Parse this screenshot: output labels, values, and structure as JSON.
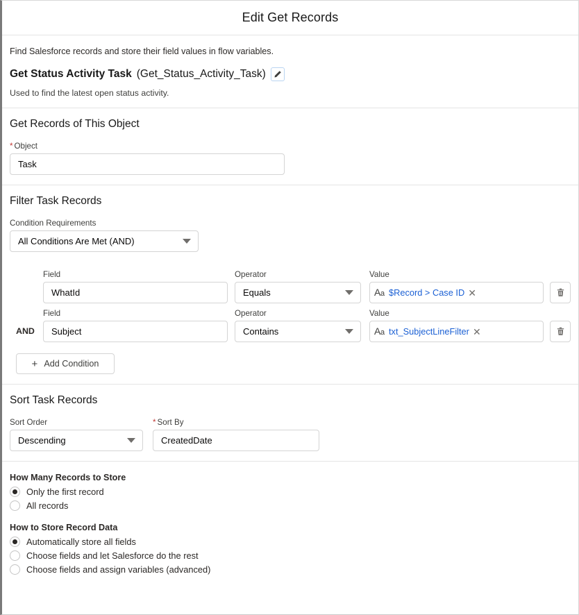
{
  "header": {
    "title": "Edit Get Records"
  },
  "intro": {
    "description": "Find Salesforce records and store their field values in flow variables.",
    "element_label": "Get Status Activity Task",
    "element_api_name": "(Get_Status_Activity_Task)",
    "edit_icon": "pencil-icon",
    "element_description": "Used to find the latest open status activity."
  },
  "object_section": {
    "title": "Get Records of This Object",
    "object_field_label": "Object",
    "object_required": "*",
    "object_value": "Task"
  },
  "filter_section": {
    "title": "Filter Task Records",
    "condition_requirements_label": "Condition Requirements",
    "condition_requirements_value": "All Conditions Are Met (AND)",
    "column_headers": {
      "field": "Field",
      "operator": "Operator",
      "value": "Value"
    },
    "logic_operator": "AND",
    "conditions": [
      {
        "field": "WhatId",
        "operator": "Equals",
        "value": "$Record > Case ID",
        "value_type_icon": "text-type-icon",
        "remove_icon": "close-icon",
        "delete_icon": "trash-icon"
      },
      {
        "field": "Subject",
        "operator": "Contains",
        "value": "txt_SubjectLineFilter",
        "value_type_icon": "text-type-icon",
        "remove_icon": "close-icon",
        "delete_icon": "trash-icon"
      }
    ],
    "add_condition_label": "Add Condition",
    "add_condition_icon": "plus-icon"
  },
  "sort_section": {
    "title": "Sort Task Records",
    "sort_order_label": "Sort Order",
    "sort_order_value": "Descending",
    "sort_by_label": "Sort By",
    "sort_by_required": "*",
    "sort_by_value": "CreatedDate"
  },
  "storage_section": {
    "how_many_title": "How Many Records to Store",
    "how_many_options": [
      {
        "label": "Only the first record",
        "selected": true
      },
      {
        "label": "All records",
        "selected": false
      }
    ],
    "how_to_store_title": "How to Store Record Data",
    "how_to_store_options": [
      {
        "label": "Automatically store all fields",
        "selected": true
      },
      {
        "label": "Choose fields and let Salesforce do the rest",
        "selected": false
      },
      {
        "label": "Choose fields and assign variables (advanced)",
        "selected": false
      }
    ]
  },
  "colors": {
    "link_blue": "#1b60d4",
    "required_red": "#c23934",
    "text_dark": "#181818",
    "border_gray": "#d4d4d4"
  }
}
